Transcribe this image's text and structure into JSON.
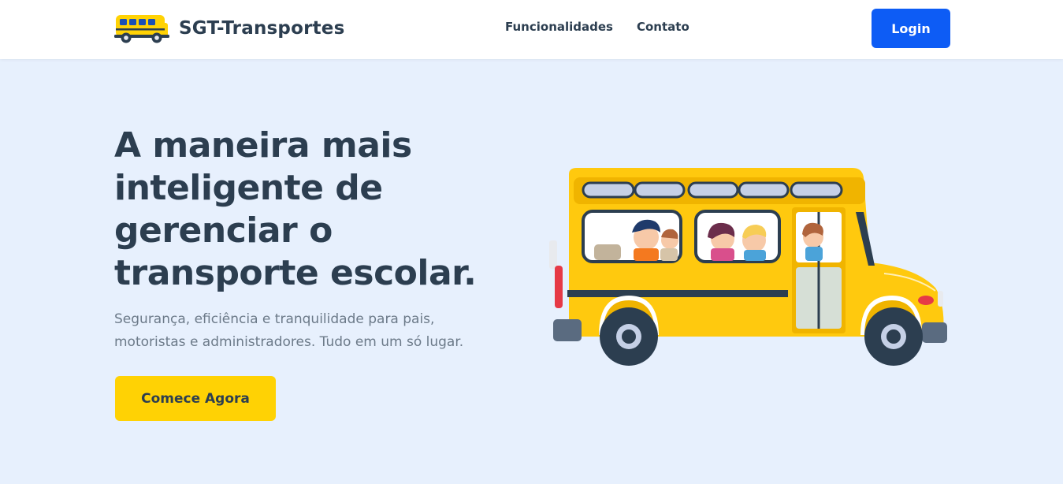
{
  "brand": {
    "name": "SGT-Transportes",
    "logo_icon": "school-bus-icon"
  },
  "nav": {
    "links": [
      "Funcionalidades",
      "Contato"
    ],
    "login_label": "Login"
  },
  "hero": {
    "title": "A maneira mais inteligente de gerenciar o transporte escolar.",
    "subtitle": "Segurança, eficiência e tranquilidade para pais, motoristas e administradores. Tudo em um só lugar.",
    "cta_label": "Comece Agora",
    "illustration": "school-bus-with-children-illustration"
  },
  "colors": {
    "primary": "#0d5cf5",
    "accent": "#ffd204",
    "hero_background": "#e7f0fd",
    "text_dark": "#2c3e50",
    "text_muted": "#6c7a89",
    "bus_yellow": "#ffc90e"
  }
}
